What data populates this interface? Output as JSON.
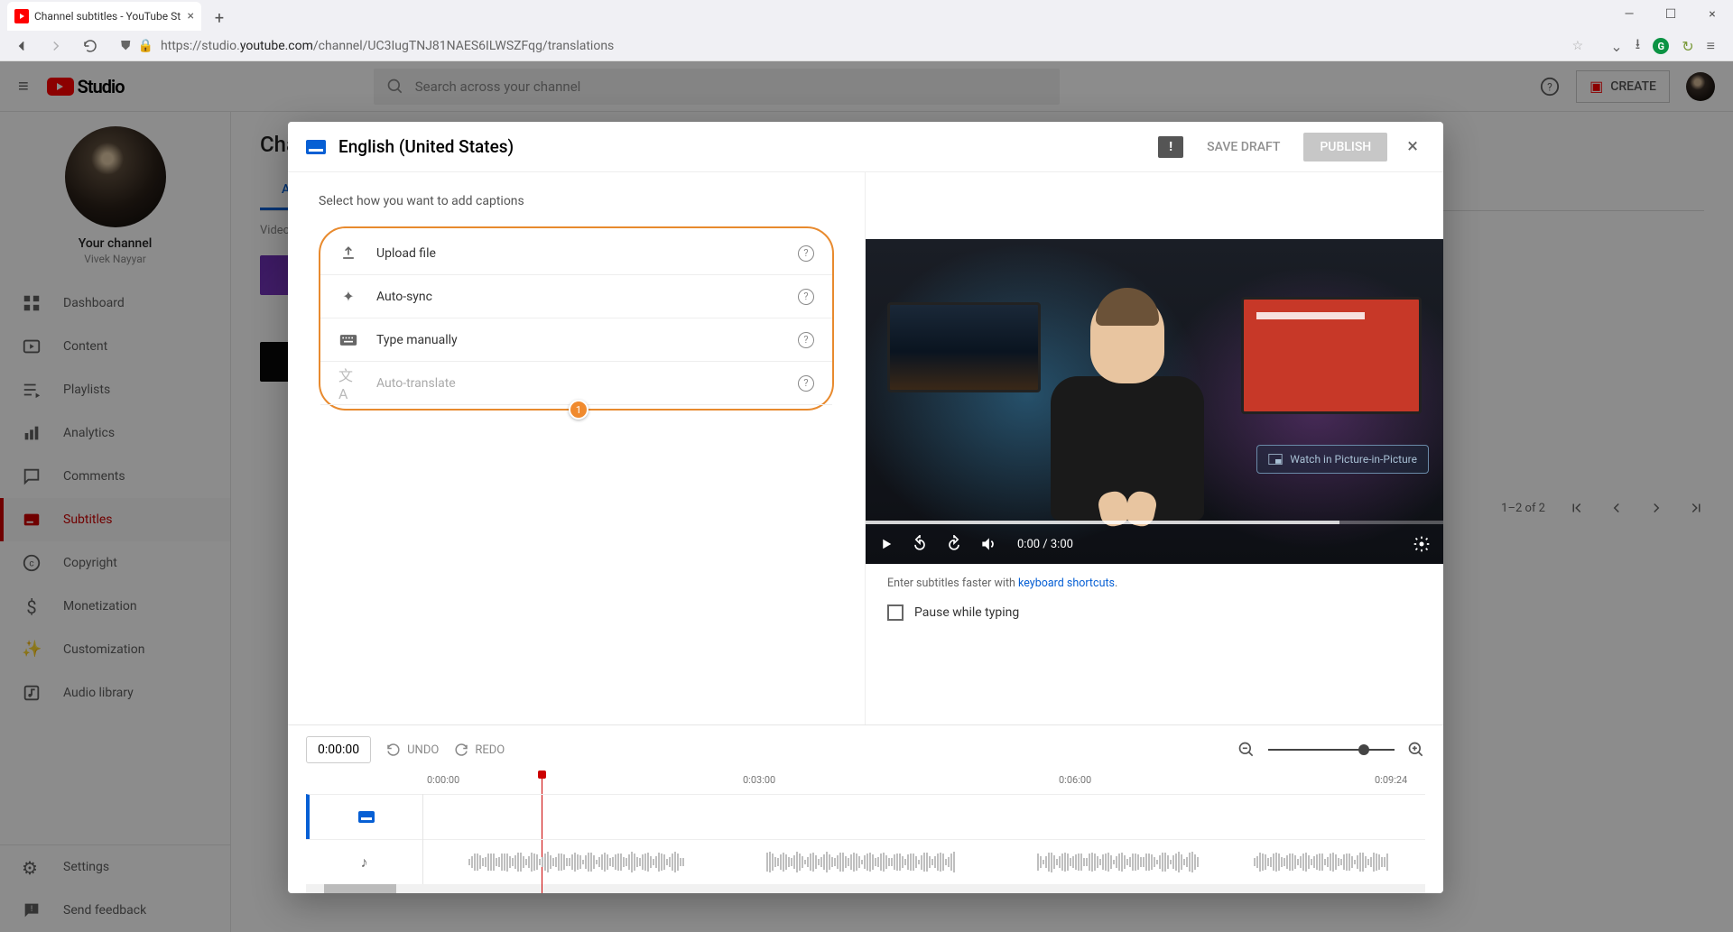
{
  "browser": {
    "tab_title": "Channel subtitles - YouTube St",
    "url_prefix": "https://studio.",
    "url_domain": "youtube.com",
    "url_path": "/channel/UC3IugTNJ81NAES6ILWSZFqg/translations"
  },
  "header": {
    "logo_text": "Studio",
    "search_placeholder": "Search across your channel",
    "create_label": "CREATE"
  },
  "sidebar": {
    "channel_label": "Your channel",
    "channel_name": "Vivek Nayyar",
    "items": [
      {
        "label": "Dashboard"
      },
      {
        "label": "Content"
      },
      {
        "label": "Playlists"
      },
      {
        "label": "Analytics"
      },
      {
        "label": "Comments"
      },
      {
        "label": "Subtitles"
      },
      {
        "label": "Copyright"
      },
      {
        "label": "Monetization"
      },
      {
        "label": "Customization"
      },
      {
        "label": "Audio library"
      }
    ],
    "footer": [
      {
        "label": "Settings"
      },
      {
        "label": "Send feedback"
      }
    ]
  },
  "page": {
    "title_partial": "Cha",
    "tab_all": "All",
    "col_video": "Video",
    "pager": "1–2 of 2"
  },
  "modal": {
    "title": "English (United States)",
    "save_draft": "SAVE DRAFT",
    "publish": "PUBLISH",
    "instruction": "Select how you want to add captions",
    "options": [
      {
        "label": "Upload file"
      },
      {
        "label": "Auto-sync"
      },
      {
        "label": "Type manually"
      },
      {
        "label": "Auto-translate"
      }
    ],
    "badge": "1",
    "pip_label": "Watch in Picture-in-Picture",
    "time_display": "0:00 / 3:00",
    "hint_prefix": "Enter subtitles faster with ",
    "hint_link": "keyboard shortcuts",
    "hint_suffix": ".",
    "pause_label": "Pause while typing",
    "timeline": {
      "current": "0:00:00",
      "undo": "UNDO",
      "redo": "REDO",
      "ticks": [
        "0:00:00",
        "0:03:00",
        "0:06:00",
        "0:09:24"
      ]
    }
  }
}
